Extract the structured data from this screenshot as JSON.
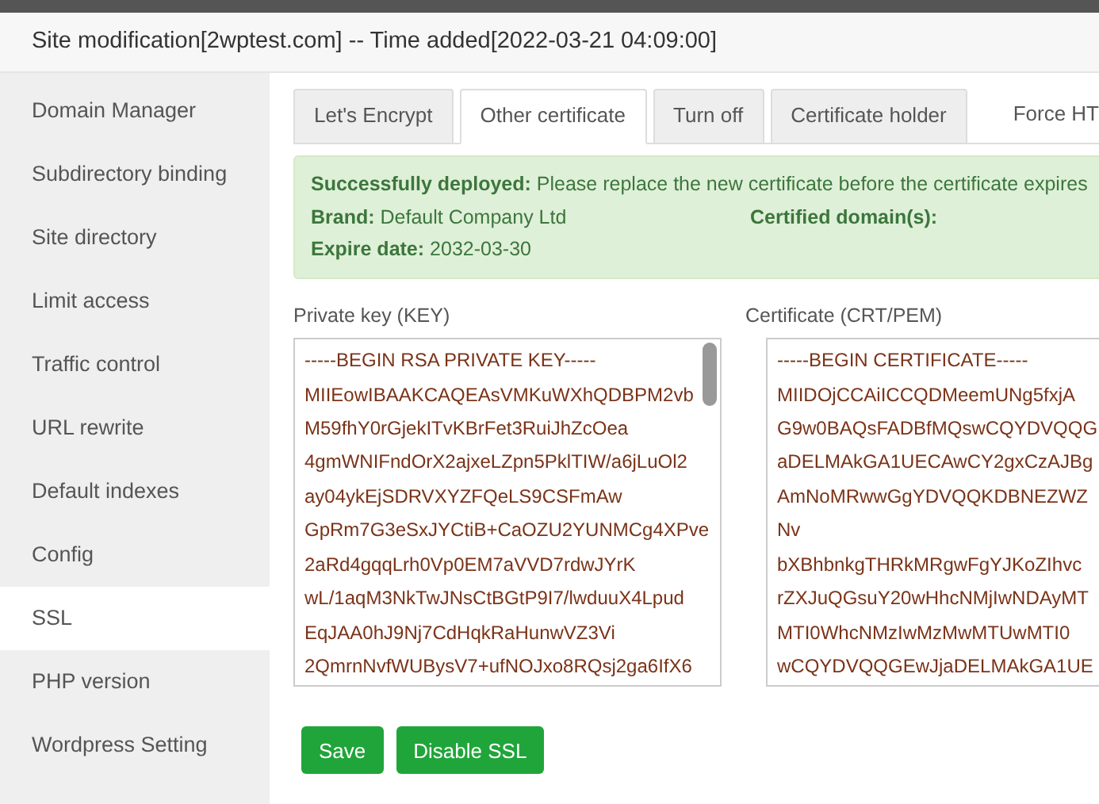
{
  "window": {
    "title": "Site modification[2wptest.com] -- Time added[2022-03-21 04:09:00]"
  },
  "sidebar": {
    "items": [
      {
        "label": "Domain Manager",
        "selected": false
      },
      {
        "label": "Subdirectory binding",
        "selected": false
      },
      {
        "label": "Site directory",
        "selected": false
      },
      {
        "label": "Limit access",
        "selected": false
      },
      {
        "label": "Traffic control",
        "selected": false
      },
      {
        "label": "URL rewrite",
        "selected": false
      },
      {
        "label": "Default indexes",
        "selected": false
      },
      {
        "label": "Config",
        "selected": false
      },
      {
        "label": "SSL",
        "selected": true
      },
      {
        "label": "PHP version",
        "selected": false
      },
      {
        "label": "Wordpress Setting",
        "selected": false
      }
    ]
  },
  "tabs": [
    {
      "label": "Let's Encrypt",
      "selected": false
    },
    {
      "label": "Other certificate",
      "selected": true
    },
    {
      "label": "Turn off",
      "selected": false
    },
    {
      "label": "Certificate holder",
      "selected": false
    }
  ],
  "force_https": {
    "label": "Force HT"
  },
  "alert": {
    "status_label": "Successfully deployed:",
    "status_text": "Please replace the new certificate before the certificate expires",
    "brand_label": "Brand:",
    "brand": "Default Company Ltd",
    "domains_label": "Certified domain(s):",
    "expire_label": "Expire date:",
    "expire": "2032-03-30"
  },
  "private_key": {
    "label": "Private key (KEY)",
    "lines": [
      "-----BEGIN RSA PRIVATE KEY-----",
      "MIIEowIBAAKCAQEAsVMKuWXhQDBPM2vb",
      "M59fhY0rGjekITvKBrFet3RuiJhZcOea",
      "4gmWNIFndOrX2ajxeLZpn5PklTIW/a6jLuOl2",
      "ay04ykEjSDRVXYZFQeLS9CSFmAw",
      "GpRm7G3eSxJYCtiB+CaOZU2YUNMCg4XPve",
      "2aRd4gqqLrh0Vp0EM7aVVD7rdwJYrK",
      "wL/1aqM3NkTwJNsCtBGtP9I7/lwduuX4Lpud",
      "EqJAA0hJ9Nj7CdHqkRaHunwVZ3Vi",
      "2QmrnNvfWUBysV7+ufNOJxo8RQsj2ga6IfX6"
    ]
  },
  "certificate": {
    "label": "Certificate (CRT/PEM)",
    "lines": [
      "-----BEGIN CERTIFICATE-----",
      "MIIDOjCCAiICCQDMeemUNg5fxjA",
      "G9w0BAQsFADBfMQswCQYDVQQG",
      "aDELMAkGA1UECAwCY2gxCzAJBg",
      "AmNoMRwwGgYDVQQKDBNEZWZ",
      "Nv",
      "bXBhbnkgTHRkMRgwFgYJKoZIhvc",
      "rZXJuQGsuY20wHhcNMjIwNDAyMT",
      "MTI0WhcNMzIwMzMwMTUwMTI0",
      "wCQYDVQQGEwJjaDELMAkGA1UE"
    ]
  },
  "buttons": [
    {
      "label": "Save"
    },
    {
      "label": "Disable SSL"
    }
  ]
}
